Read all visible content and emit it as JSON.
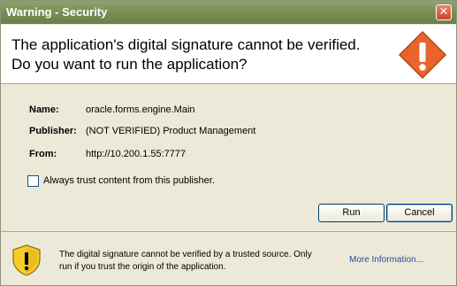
{
  "window": {
    "title": "Warning - Security",
    "close_glyph": "✕"
  },
  "header": {
    "line1": "The application's digital signature cannot be verified.",
    "line2": "Do you want to run the application?",
    "icon": "warning-shield-icon",
    "icon_color": "#e8642a"
  },
  "details": [
    {
      "label": "Name:",
      "value": "oracle.forms.engine.Main"
    },
    {
      "label": "Publisher:",
      "value": "(NOT VERIFIED) Product Management"
    },
    {
      "label": "From:",
      "value": "http://10.200.1.55:7777"
    }
  ],
  "checkbox": {
    "label": "Always trust content from this publisher.",
    "checked": false
  },
  "buttons": {
    "run": "Run",
    "cancel": "Cancel"
  },
  "footer": {
    "line1": "The digital signature cannot be verified by a trusted source.  Only",
    "line2": "run if you trust the origin of the application.",
    "more_info": "More Information...",
    "icon": "yellow-warning-shield-icon"
  }
}
